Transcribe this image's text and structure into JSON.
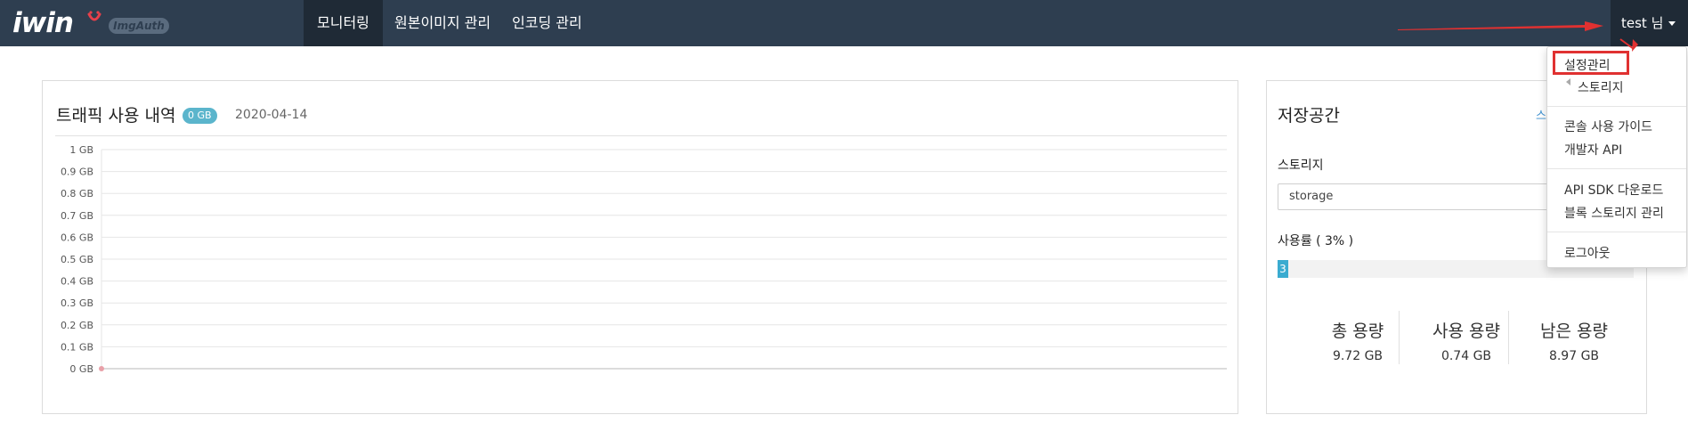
{
  "brand": {
    "logo_text": "iwin",
    "badge": "ImgAuth",
    "logo_icon": "smile-icon"
  },
  "nav": {
    "tabs": [
      {
        "label": "모니터링",
        "active": true
      },
      {
        "label": "원본이미지 관리",
        "active": false
      },
      {
        "label": "인코딩 관리",
        "active": false
      }
    ],
    "user_label": "test 님"
  },
  "dropdown": {
    "items": [
      "설정관리",
      "스토리지",
      "콘솔 사용 가이드",
      "개발자 API",
      "API SDK 다운로드",
      "블록 스토리지 관리",
      "로그아웃"
    ],
    "highlighted": "설정관리"
  },
  "traffic": {
    "title": "트래픽 사용 내역",
    "badge": "0 GB",
    "date": "2020-04-14"
  },
  "chart_data": {
    "type": "line",
    "yticks": [
      "1 GB",
      "0.9 GB",
      "0.8 GB",
      "0.7 GB",
      "0.6 GB",
      "0.5 GB",
      "0.4 GB",
      "0.3 GB",
      "0.2 GB",
      "0.1 GB",
      "0 GB"
    ],
    "ylim": [
      0,
      1
    ],
    "series": [
      {
        "values": [
          0
        ]
      }
    ],
    "grid": true,
    "marker_color": "#e8a0a8"
  },
  "storage": {
    "title": "저장공간",
    "link": "스",
    "storage_label": "스토리지",
    "select_value": "storage",
    "usage_label": "사용률 ( 3% )",
    "usage_percent": 3,
    "usage_text": "3",
    "stats": [
      {
        "label": "총 용량",
        "value": "9.72 GB"
      },
      {
        "label": "사용 용량",
        "value": "0.74 GB"
      },
      {
        "label": "남은 용량",
        "value": "8.97 GB"
      }
    ]
  },
  "colors": {
    "navbar": "#2e3e50",
    "active_tab": "#1f2a36",
    "accent": "#3aabd0",
    "annotation": "#e03131"
  }
}
